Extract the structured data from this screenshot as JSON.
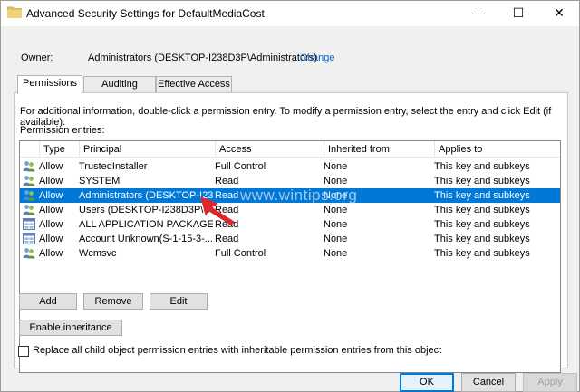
{
  "window": {
    "title": "Advanced Security Settings for DefaultMediaCost",
    "controls": {
      "minimize": "—",
      "maximize": "☐",
      "close": "✕"
    }
  },
  "owner": {
    "label": "Owner:",
    "value": "Administrators (DESKTOP-I238D3P\\Administrators)",
    "change_link": "Change"
  },
  "tabs": [
    {
      "label": "Permissions",
      "active": true
    },
    {
      "label": "Auditing",
      "active": false
    },
    {
      "label": "Effective Access",
      "active": false
    }
  ],
  "panel": {
    "info": "For additional information, double-click a permission entry. To modify a permission entry, select the entry and click Edit (if available).",
    "entries_label": "Permission entries:"
  },
  "table": {
    "headers": [
      "Type",
      "Principal",
      "Access",
      "Inherited from",
      "Applies to"
    ],
    "rows": [
      {
        "icon": "users-icon",
        "type": "Allow",
        "principal": "TrustedInstaller",
        "access": "Full Control",
        "inherited": "None",
        "applies": "This key and subkeys",
        "selected": false
      },
      {
        "icon": "users-icon",
        "type": "Allow",
        "principal": "SYSTEM",
        "access": "Read",
        "inherited": "None",
        "applies": "This key and subkeys",
        "selected": false
      },
      {
        "icon": "users-icon",
        "type": "Allow",
        "principal": "Administrators (DESKTOP-I23...",
        "access": "Read",
        "inherited": "None",
        "applies": "This key and subkeys",
        "selected": true
      },
      {
        "icon": "users-icon",
        "type": "Allow",
        "principal": "Users (DESKTOP-I238D3P\\Use",
        "access": "Read",
        "inherited": "None",
        "applies": "This key and subkeys",
        "selected": false
      },
      {
        "icon": "package-icon",
        "type": "Allow",
        "principal": "ALL APPLICATION PACKAGES",
        "access": "Read",
        "inherited": "None",
        "applies": "This key and subkeys",
        "selected": false
      },
      {
        "icon": "package-icon",
        "type": "Allow",
        "principal": "Account Unknown(S-1-15-3-...",
        "access": "Read",
        "inherited": "None",
        "applies": "This key and subkeys",
        "selected": false
      },
      {
        "icon": "users-icon",
        "type": "Allow",
        "principal": "Wcmsvc",
        "access": "Full Control",
        "inherited": "None",
        "applies": "This key and subkeys",
        "selected": false
      }
    ]
  },
  "buttons": {
    "add": "Add",
    "remove": "Remove",
    "edit": "Edit",
    "enable_inheritance": "Enable inheritance",
    "ok": "OK",
    "cancel": "Cancel",
    "apply": "Apply"
  },
  "replace_checkbox": {
    "label": "Replace all child object permission entries with inheritable permission entries from this object",
    "checked": false
  },
  "watermark": "www.wintips.org",
  "colors": {
    "selection": "#0078d7",
    "link": "#0066cc",
    "arrow": "#e0262a",
    "folder": "#e8c25a"
  }
}
